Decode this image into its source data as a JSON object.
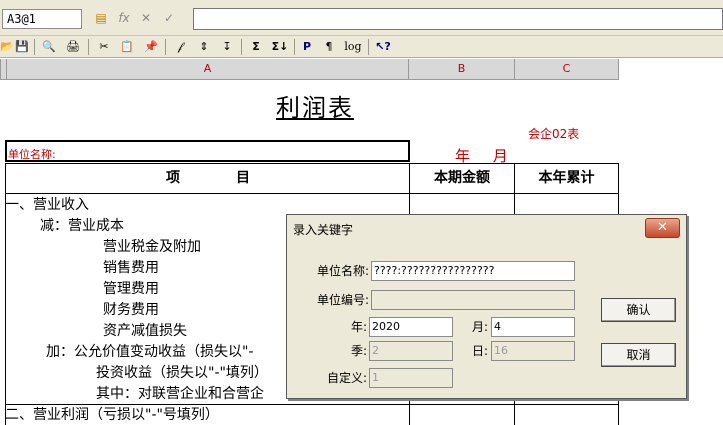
{
  "formula_bar": {
    "cell_ref": "A3@1",
    "fx": "fx",
    "cancel": "✕",
    "confirm": "✓"
  },
  "toolbar": {
    "icons": [
      "📂",
      "💾",
      "🔍",
      "🖨",
      "✂",
      "📋",
      "📌",
      "𝒻",
      "⇕",
      "↧",
      "Σ",
      "Σ↓",
      "P",
      "¶",
      "log",
      "↖?"
    ]
  },
  "columns": [
    "A",
    "B",
    "C"
  ],
  "sheet": {
    "title": "利润表",
    "form_code": "会企02表",
    "unit_label": "单位名称:",
    "year_month": "年 月",
    "header": {
      "item": "项　　　　目",
      "current": "本期金额",
      "cumulative": "本年累计"
    },
    "rows": [
      "一、营业收入",
      "减：营业成本",
      "营业税金及附加",
      "销售费用",
      "管理费用",
      "财务费用",
      "资产减值损失",
      "加：公允价值变动收益（损失以\"-",
      "投资收益（损失以\"-\"填列）",
      "其中：对联营企业和合营企",
      "二、营业利润（亏损以\"-\"号填列）"
    ]
  },
  "dialog": {
    "title": "录入关键字",
    "close": "✕",
    "unit_name_label": "单位名称:",
    "unit_name_value": "????:????????????????",
    "unit_code_label": "单位编号:",
    "unit_code_value": "",
    "year_label": "年:",
    "year_value": "2020",
    "month_label": "月:",
    "month_value": "4",
    "quarter_label": "季:",
    "quarter_value": "2",
    "day_label": "日:",
    "day_value": "16",
    "custom_label": "自定义:",
    "custom_value": "1",
    "ok": "确认",
    "cancel": "取消"
  }
}
